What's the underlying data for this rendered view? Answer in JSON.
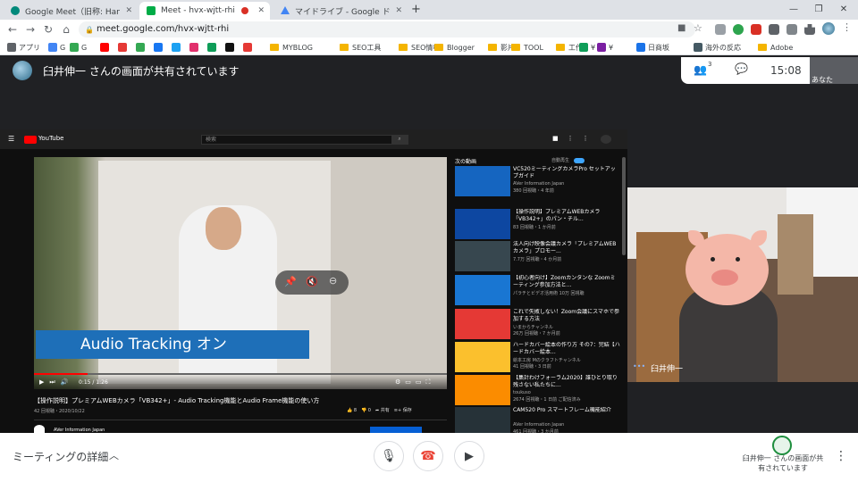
{
  "tabs": [
    {
      "title": "Google Meet（旧称: Hangouts M...",
      "color": "#00897b"
    },
    {
      "title": "Meet - hvx-wjtt-rhi",
      "color": "#00ac47",
      "recording": true
    },
    {
      "title": "マイドライブ - Google ドライブ",
      "color": "#4285f4"
    }
  ],
  "address": "meet.google.com/hvx-wjtt-rhi",
  "bookmarks": [
    {
      "label": "アプリ",
      "type": "icon",
      "color": "#5f6368"
    },
    {
      "label": "G",
      "type": "icon",
      "color": "#4285f4"
    },
    {
      "label": "G",
      "type": "icon",
      "color": "#34a853"
    },
    {
      "label": "MYBLOG",
      "type": "folder"
    },
    {
      "label": "SEO工具",
      "type": "folder"
    },
    {
      "label": "SEO情報",
      "type": "folder"
    },
    {
      "label": "Blogger",
      "type": "folder"
    },
    {
      "label": "影片",
      "type": "folder"
    },
    {
      "label": "TOOL",
      "type": "folder"
    },
    {
      "label": "工作",
      "type": "folder"
    },
    {
      "label": "¥",
      "type": "icon",
      "color": "#0f9d58"
    },
    {
      "label": "¥",
      "type": "icon",
      "color": "#7b1fa2"
    },
    {
      "label": "日商坂",
      "type": "icon",
      "color": "#1a73e8"
    },
    {
      "label": "海外の反応",
      "type": "icon",
      "color": "#455a64"
    },
    {
      "label": "Adobe",
      "type": "folder"
    }
  ],
  "meet": {
    "presenter_text": "臼井伸一 さんの画面が共有されています",
    "participant_count": "3",
    "clock": "15:08",
    "self_label": "あなた",
    "participant_name": "臼井伸一",
    "details": "ミーティングの詳細",
    "presenting_text": "臼井伸一 さんの画面が共有されています"
  },
  "youtube": {
    "search_placeholder": "検索",
    "logo": "YouTube",
    "video_title": "【操作説明】プレミアムWEBカメラ「VB342+」- Audio Tracking機能とAudio Frame機能の使い方",
    "views": "42 回視聴・2020/10/22",
    "time": "0:15 / 1:26",
    "caption": "Audio Tracking オン",
    "channel": "AVer Information Japan",
    "actions": "👍 8　👎 0　➦ 共有　≡+ 保存",
    "up_next": "次の動画",
    "autoplay": "自動再生",
    "recommendations": [
      {
        "title": "VC520ミーティングカメラPro セットアップガイド",
        "meta": "AVer Information Japan",
        "meta2": "380 回視聴・4 年前",
        "color": "#1565c0"
      },
      {
        "title": "【操作説明】プレミアムWEBカメラ「VB342+」のパン・チル...",
        "meta": "83 回視聴・1 か月前",
        "meta2": "",
        "color": "#0d47a1"
      },
      {
        "title": "法人向け映像会議カメラ「プレミアムWEBカメラ」プロモー...",
        "meta": "7.7万 回視聴・4 か月前",
        "meta2": "",
        "color": "#37474f"
      },
      {
        "title": "【初心者向け】Zoomカンタンな Zoomミーティング参加方法と...",
        "meta": "パラチとビデオ活用術 10万 回視聴",
        "meta2": "",
        "color": "#1976d2"
      },
      {
        "title": "これで失敗しない！Zoom会議にスマホで参加する方法",
        "meta": "いまからチャンネル",
        "meta2": "26万 回視聴・7 か月前",
        "color": "#e53935"
      },
      {
        "title": "ハードカバー絵本の作り方 その7：完結【ハードカバー絵本...",
        "meta": "絵本工房 Mのクラフトチャンネル",
        "meta2": "41 回視聴・3 日前",
        "color": "#fbc02d"
      },
      {
        "title": "【集計わけフォーラム2020】誰ひとり取り残さない私たちに...",
        "meta": "toukuso",
        "meta2": "2674 回視聴・1 日前 ご配信済み",
        "color": "#fb8c00"
      },
      {
        "title": "CAM520 Pro スマートフレーム機能紹介",
        "meta": "AVer Information Japan",
        "meta2": "461 回視聴・3 か月前",
        "color": "#263238"
      }
    ]
  },
  "colors": {
    "accent": "#1a73e8",
    "hangup": "#ea4335",
    "present": "#1e8e3e"
  }
}
